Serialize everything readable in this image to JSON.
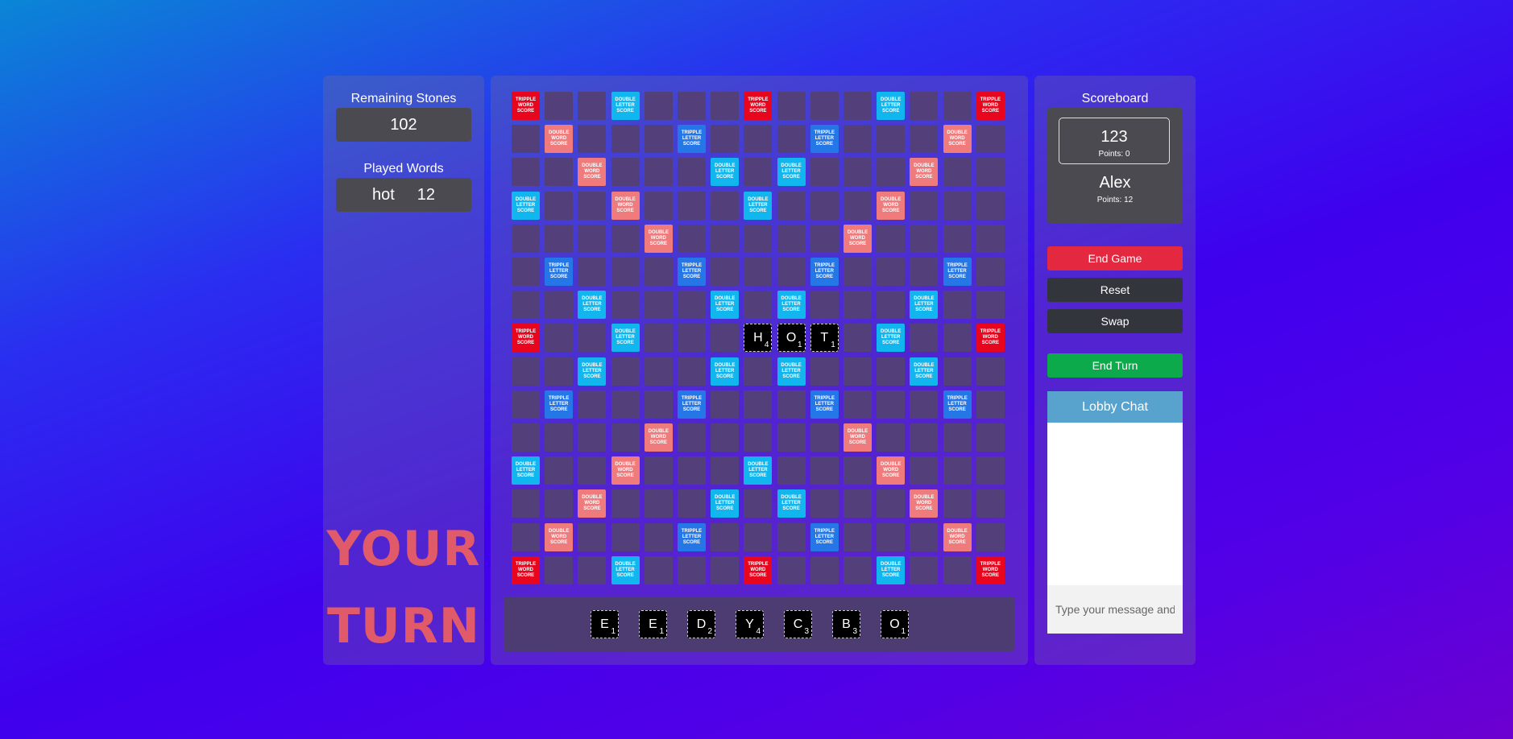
{
  "left": {
    "remaining_title": "Remaining Stones",
    "remaining_count": "102",
    "played_title": "Played Words",
    "played_words": [
      {
        "word": "hot",
        "points": "12"
      }
    ],
    "your_turn_line1": "YOUR",
    "your_turn_line2": "TURN"
  },
  "bonus_labels": {
    "tw": "TRIPPLE WORD SCORE",
    "dw": "DOUBLE WORD SCORE",
    "dl": "DOUBLE LETTER SCORE",
    "tl": "TRIPPLE LETTER SCORE"
  },
  "board": {
    "size": 15,
    "bonus_rows": [
      "T..D...T...D..T",
      ".W...L...L...W.",
      "..W...d.d...W..",
      "d..W...d...W...",
      "....W.....W....",
      ".L...L...L...L.",
      "..d...d.d...d..",
      "T..d.......d..T",
      "..d...d.d...d..",
      ".L...L...L...L.",
      "....W.....W....",
      "d..W...d...W...",
      "..W...d.d...W..",
      ".W...L...L...W.",
      "T..d...T...d..T"
    ],
    "tiles": [
      {
        "row": 7,
        "col": 7,
        "letter": "H",
        "points": "4"
      },
      {
        "row": 7,
        "col": 8,
        "letter": "O",
        "points": "1"
      },
      {
        "row": 7,
        "col": 9,
        "letter": "T",
        "points": "1"
      }
    ]
  },
  "rack": [
    {
      "letter": "E",
      "points": "1"
    },
    {
      "letter": "E",
      "points": "1"
    },
    {
      "letter": "D",
      "points": "2"
    },
    {
      "letter": "Y",
      "points": "4"
    },
    {
      "letter": "C",
      "points": "3"
    },
    {
      "letter": "B",
      "points": "3"
    },
    {
      "letter": "O",
      "points": "1"
    }
  ],
  "scoreboard": {
    "title": "Scoreboard",
    "players": [
      {
        "name": "123",
        "points": "Points: 0"
      },
      {
        "name": "Alex",
        "points": "Points: 12"
      }
    ]
  },
  "actions": {
    "end_game": "End Game",
    "reset": "Reset",
    "swap": "Swap",
    "end_turn": "End Turn"
  },
  "chat": {
    "title": "Lobby Chat",
    "placeholder": "Type your message and press enter"
  }
}
